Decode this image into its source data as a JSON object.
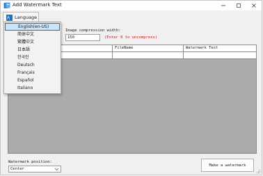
{
  "window": {
    "title": "Add Watermark Text",
    "controls": [
      "minimize-icon",
      "maximize-icon",
      "close-icon"
    ]
  },
  "menu": {
    "language_label": "Language"
  },
  "language_dropdown": {
    "items": [
      {
        "label": "English(en-US)",
        "selected": true
      },
      {
        "label": "简体中文",
        "selected": false
      },
      {
        "label": "繁體中文",
        "selected": false
      },
      {
        "label": "日本語",
        "selected": false
      },
      {
        "label": "한국인",
        "selected": false
      },
      {
        "label": "Deutsch",
        "selected": false
      },
      {
        "label": "Français",
        "selected": false
      },
      {
        "label": "Español",
        "selected": false
      },
      {
        "label": "Italiano",
        "selected": false
      }
    ]
  },
  "compression": {
    "label": "Image compression width:",
    "value": "150",
    "hint": "(Enter 0 to uncompress)"
  },
  "grid": {
    "columns": [
      "",
      "FileName",
      "Watermark Text"
    ]
  },
  "watermark_position": {
    "label": "Watermark position:",
    "value": "Center"
  },
  "actions": {
    "make_label": "Make a watermark"
  },
  "colors": {
    "accent": "#0078d4",
    "hint": "#dd1111",
    "grid_bg": "#ababab"
  }
}
